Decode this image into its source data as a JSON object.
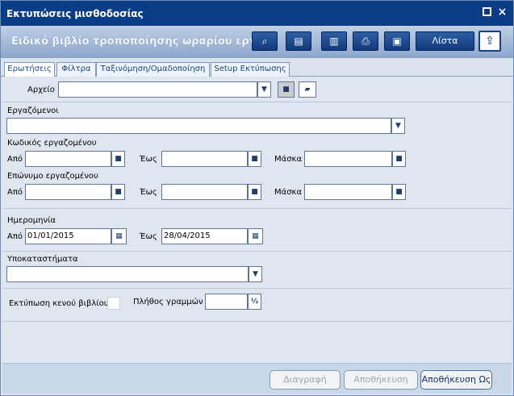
{
  "window": {
    "title": "Εκτυπώσεις μισθοδοσίας",
    "subtitle": "Ειδικό βιβλίο τροποποίησης ωραρίου εργασίας",
    "toolbar": {
      "list_label": "Λίστα"
    }
  },
  "tabs": [
    {
      "label": "Ερωτήσεις"
    },
    {
      "label": "Φίλτρα"
    },
    {
      "label": "Ταξινόμηση/Ομαδοποίηση"
    },
    {
      "label": "Setup Εκτύπωσης"
    }
  ],
  "file": {
    "label": "Αρχείο",
    "value": ""
  },
  "employees": {
    "label": "Εργαζόμενοι",
    "value": ""
  },
  "employee_code": {
    "label": "Κωδικός εργαζομένου",
    "from_label": "Από",
    "to_label": "Έως",
    "mask_label": "Μάσκα",
    "from": "",
    "to": "",
    "mask": ""
  },
  "employee_surname": {
    "label": "Επώνυμο εργαζομένου",
    "from_label": "Από",
    "to_label": "Έως",
    "mask_label": "Μάσκα",
    "from": "",
    "to": "",
    "mask": ""
  },
  "date": {
    "label": "Ημερομηνία",
    "from_label": "Από",
    "to_label": "Έως",
    "from": "01/01/2015",
    "to": "28/04/2015"
  },
  "branches": {
    "label": "Υποκαταστήματα",
    "value": ""
  },
  "options": {
    "print_empty_label": "Εκτύπωση κενού βιβλίου",
    "line_count_label": "Πλήθος γραμμών",
    "line_count_value": ""
  },
  "buttons": {
    "delete": "Διαγραφή",
    "save": "Αποθήκευση",
    "save_as": "Αποθήκευση Ως"
  },
  "icons": {
    "search": "search-icon",
    "report": "report-icon",
    "columns": "columns-icon",
    "print": "print-icon",
    "preview": "preview-icon",
    "export": "export-icon",
    "dropdown": "chevron-down-icon",
    "lookup": "lookup-icon",
    "calendar": "calendar-icon",
    "clear": "clear-icon"
  },
  "colors": {
    "title_bar": "#0a3d86",
    "accent": "#1b447d",
    "panel": "#dfe6ef"
  }
}
